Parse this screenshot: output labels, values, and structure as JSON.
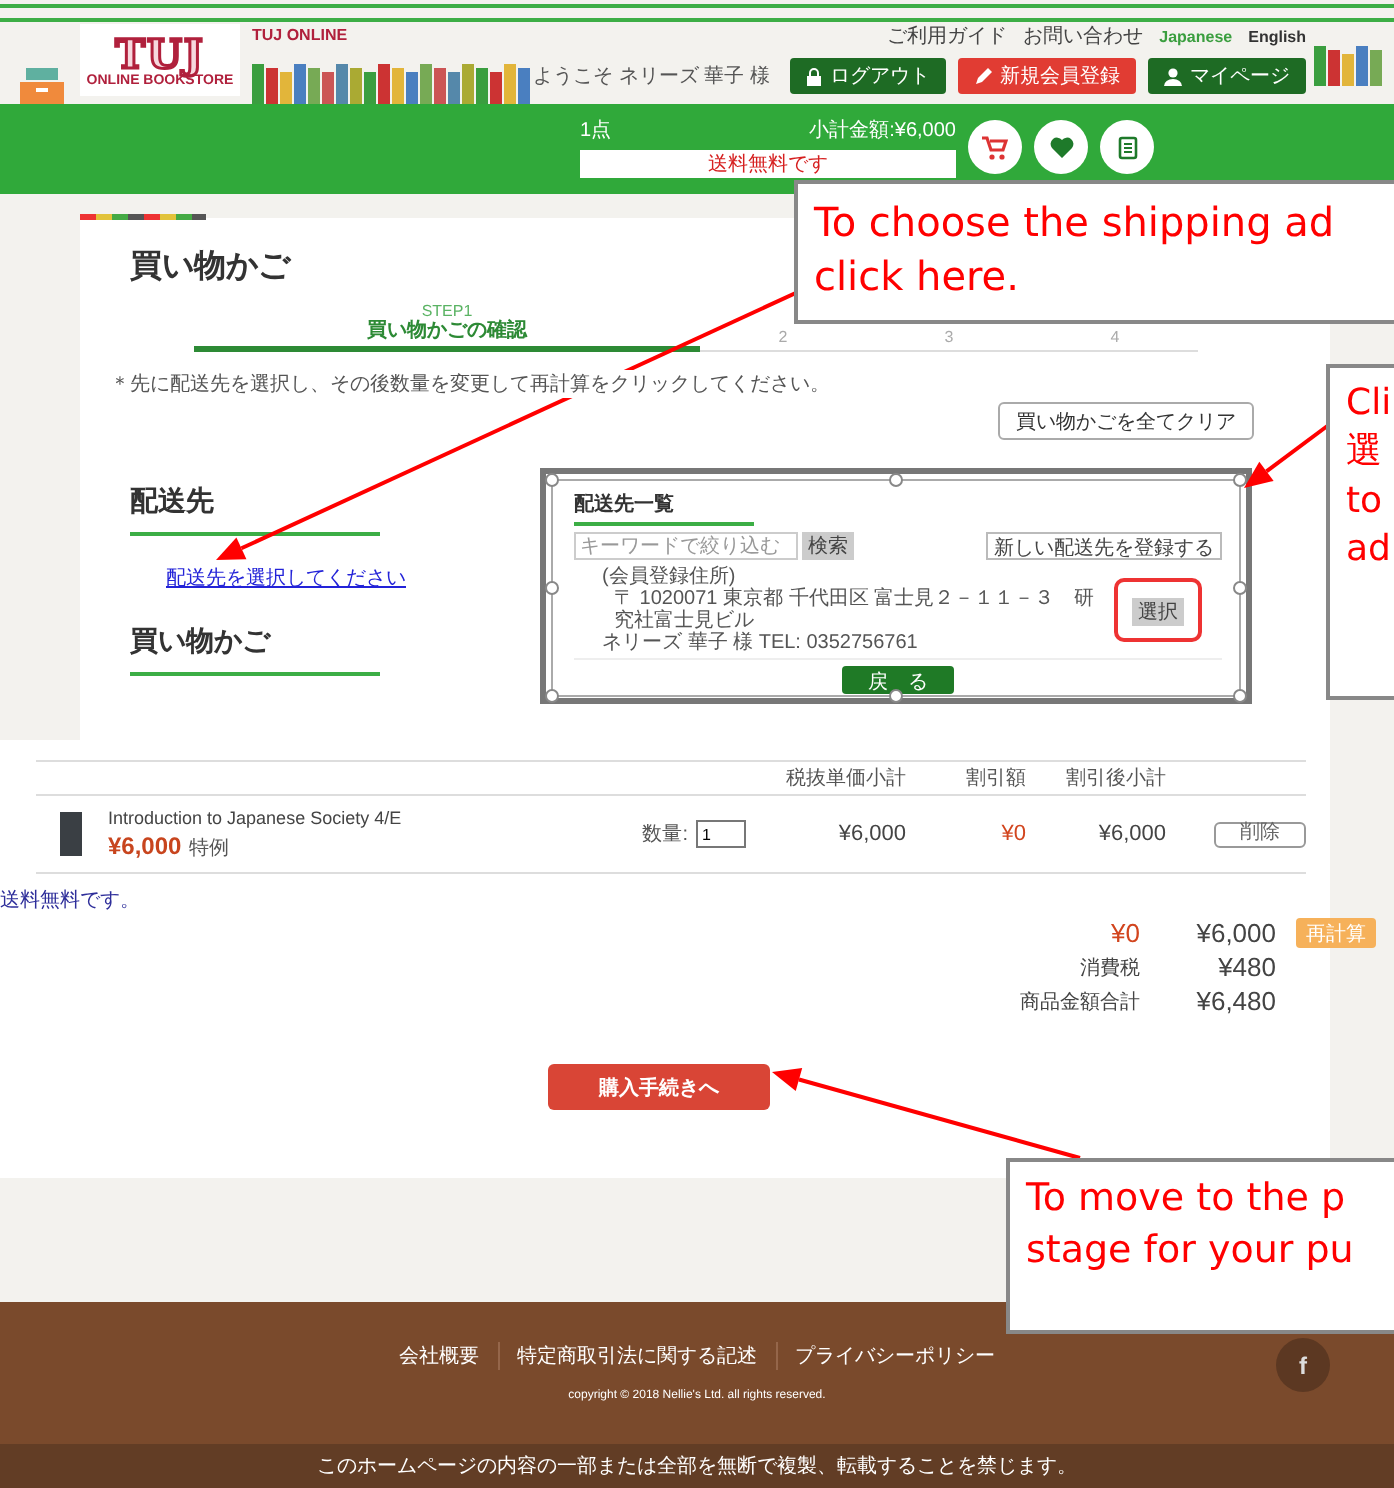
{
  "header": {
    "logo": {
      "title": "TUJ",
      "subtitle": "ONLINE BOOKSTORE"
    },
    "site_name": "TUJ ONLINE",
    "top_links": [
      "ご利用ガイド",
      "お問い合わせ"
    ],
    "languages": [
      {
        "label": "Japanese",
        "selected": true
      },
      {
        "label": "English",
        "selected": false
      }
    ],
    "welcome": "ようこそ ネリーズ 華子 様",
    "buttons": [
      {
        "kind": "logout",
        "label": "ログアウト"
      },
      {
        "kind": "register",
        "label": "新規会員登録"
      },
      {
        "kind": "mypage",
        "label": "マイページ"
      }
    ]
  },
  "cart_bar": {
    "count": "1点",
    "subtotal": "小計金額:¥6,000",
    "shipping_note": "送料無料です"
  },
  "page": {
    "title": "買い物かご",
    "steps": [
      {
        "label": "STEP1",
        "title": "買い物かごの確認",
        "selected": true
      },
      {
        "label": "2",
        "selected": false
      },
      {
        "label": "3",
        "selected": false
      },
      {
        "label": "4",
        "selected": false
      }
    ],
    "note": "＊先に配送先を選択し、その後数量を変更して再計算をクリックしてください。",
    "clear_button": "買い物かごを全てクリア",
    "shipping": {
      "heading": "配送先",
      "link": "配送先を選択してください"
    },
    "cart_heading": "買い物かご"
  },
  "address_dialog": {
    "title": "配送先一覧",
    "search_placeholder": "キーワードで絞り込む",
    "search_button": "検索",
    "new_button": "新しい配送先を登録する",
    "address": {
      "label": "(会員登録住所)",
      "line": "〒 1020071 東京都 千代田区 富士見２－１１－３　研究社富士見ビル",
      "name": "ネリーズ 華子 様 TEL: 0352756761"
    },
    "select_button": "選択",
    "back_button": "戻　る"
  },
  "cart_table": {
    "columns": [
      "税抜単価小計",
      "割引額",
      "割引後小計"
    ],
    "rows": [
      {
        "title": "Introduction to Japanese Society 4/E",
        "price": "¥6,000",
        "price_tag": "特例",
        "quantity_label": "数量:",
        "quantity": "1",
        "unit_subtotal": "¥6,000",
        "discount": "¥0",
        "after_discount": "¥6,000",
        "delete_button": "削除"
      }
    ],
    "shipping_note": "送料無料です。",
    "totals": {
      "discount": "¥0",
      "subtotal": "¥6,000",
      "recalc_button": "再計算",
      "tax_label": "消費税",
      "tax": "¥480",
      "total_label": "商品金額合計",
      "total": "¥6,480"
    },
    "checkout_button": "購入手続きへ"
  },
  "footer": {
    "links": [
      "会社概要",
      "特定商取引法に関する記述",
      "プライバシーポリシー"
    ],
    "copyright": "copyright © 2018 Nellie's Ltd. all rights reserved.",
    "social": "f",
    "notice": "このホームページの内容の一部または全部を無断で複製、転載することを禁じます。"
  },
  "annotations": [
    {
      "kind": "top",
      "lines": [
        "To choose the shipping ad",
        "click here."
      ]
    },
    {
      "kind": "right",
      "lines": [
        "Cli",
        "選",
        "to",
        "ad"
      ]
    },
    {
      "kind": "bottom",
      "lines": [
        "To move to the p",
        "stage for your pu"
      ]
    }
  ]
}
